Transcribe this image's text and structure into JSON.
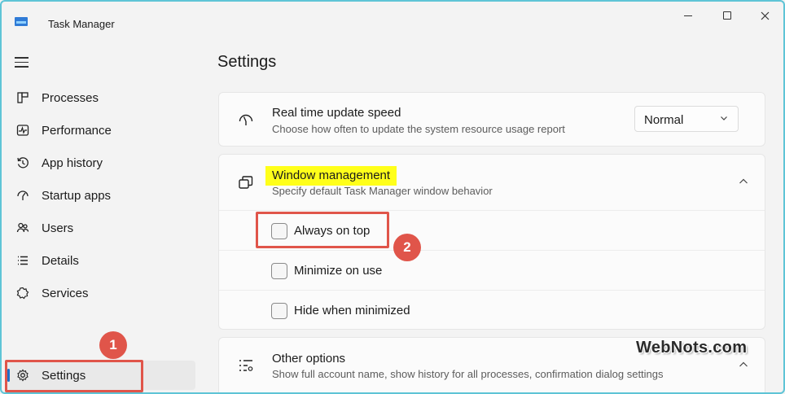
{
  "window": {
    "title": "Task Manager",
    "controls": {
      "minimize": "minimize-icon",
      "maximize": "maximize-icon",
      "close": "close-icon"
    }
  },
  "sidebar": {
    "menu_icon": "hamburger-icon",
    "items": [
      {
        "label": "Processes",
        "icon": "processes-icon"
      },
      {
        "label": "Performance",
        "icon": "performance-icon"
      },
      {
        "label": "App history",
        "icon": "history-icon"
      },
      {
        "label": "Startup apps",
        "icon": "startup-icon"
      },
      {
        "label": "Users",
        "icon": "users-icon"
      },
      {
        "label": "Details",
        "icon": "details-icon"
      },
      {
        "label": "Services",
        "icon": "services-icon"
      }
    ],
    "settings": {
      "label": "Settings",
      "icon": "gear-icon",
      "active": true
    }
  },
  "main": {
    "title": "Settings",
    "update_speed": {
      "title": "Real time update speed",
      "desc": "Choose how often to update the system resource usage report",
      "value": "Normal"
    },
    "window_management": {
      "title": "Window management",
      "desc": "Specify default Task Manager window behavior",
      "options": [
        {
          "label": "Always on top",
          "checked": false
        },
        {
          "label": "Minimize on use",
          "checked": false
        },
        {
          "label": "Hide when minimized",
          "checked": false
        }
      ]
    },
    "other_options": {
      "title": "Other options",
      "desc": "Show full account name, show history for all processes, confirmation dialog settings"
    }
  },
  "annotations": {
    "step1": "1",
    "step2": "2",
    "highlight_color": "#ffff1a",
    "callout_color": "#e0554a"
  },
  "watermark": "WebNots.com"
}
